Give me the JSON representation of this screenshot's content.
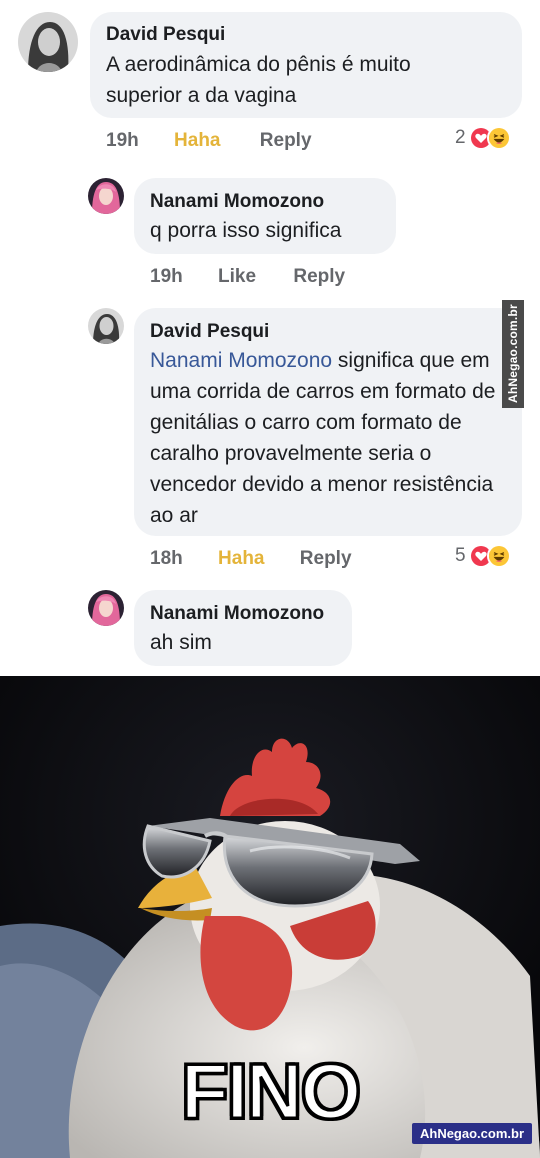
{
  "comments": [
    {
      "author": "David Pesqui",
      "text": "A aerodinâmica do pênis é muito superior a da vagina",
      "time": "19h",
      "reaction_label": "Haha",
      "reply_label": "Reply",
      "reaction_count": "2"
    },
    {
      "author": "Nanami Momozono",
      "text": "q porra isso significa",
      "time": "19h",
      "reaction_label": "Like",
      "reply_label": "Reply"
    },
    {
      "author": "David Pesqui",
      "mention": "Nanami Momozono",
      "text": " significa que em uma corrida de carros em formato de genitálias o carro com formato de caralho provavelmente seria o vencedor devido a menor resistência ao ar",
      "time": "18h",
      "reaction_label": "Haha",
      "reply_label": "Reply",
      "reaction_count": "5"
    },
    {
      "author": "Nanami Momozono",
      "text": "ah sim"
    }
  ],
  "side_watermark": "AhNegao.com.br",
  "meme": {
    "caption": "FINO",
    "watermark": "AhNegao.com.br"
  },
  "colors": {
    "bubble": "#f0f2f5",
    "meta": "#65676b",
    "haha": "#e4b43a",
    "mention": "#385898",
    "love": "#f0384f",
    "haha_face": "#fcc636"
  }
}
